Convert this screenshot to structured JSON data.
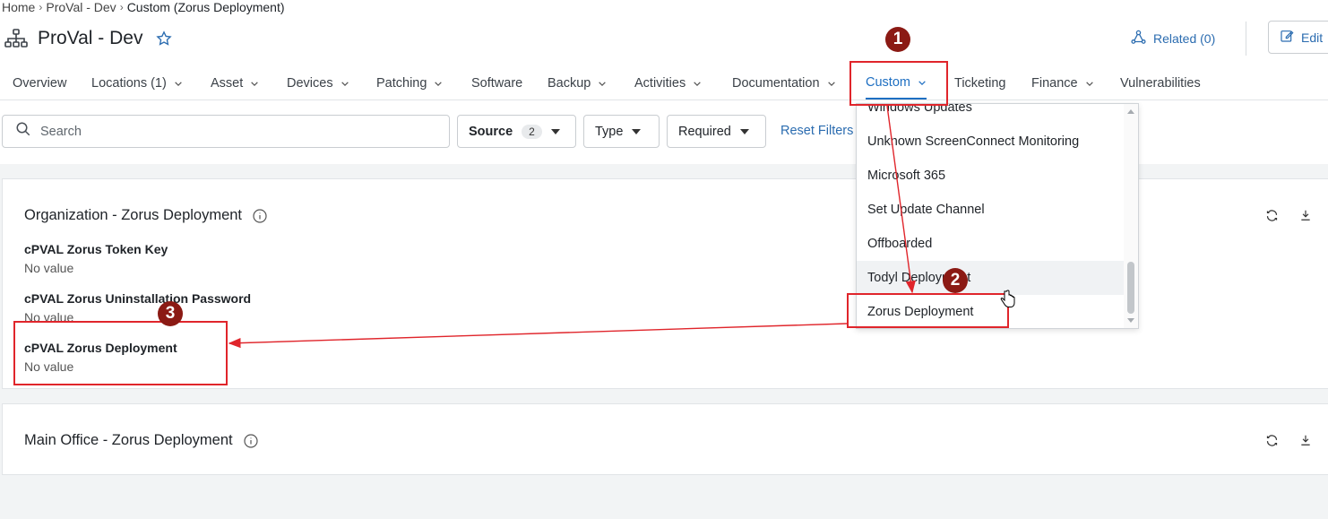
{
  "breadcrumb": [
    "Home",
    "ProVal - Dev",
    "Custom (Zorus Deployment)"
  ],
  "header": {
    "title": "ProVal - Dev",
    "related_label": "Related (0)",
    "edit_label": "Edit"
  },
  "tabs": [
    {
      "label": "Overview"
    },
    {
      "label": "Locations (1)"
    },
    {
      "label": "Asset"
    },
    {
      "label": "Devices"
    },
    {
      "label": "Patching"
    },
    {
      "label": "Software"
    },
    {
      "label": "Backup"
    },
    {
      "label": "Activities"
    },
    {
      "label": "Documentation"
    },
    {
      "label": "Custom",
      "active": true
    },
    {
      "label": "Ticketing"
    },
    {
      "label": "Finance"
    },
    {
      "label": "Vulnerabilities"
    }
  ],
  "filters": {
    "search_placeholder": "Search",
    "source_label": "Source",
    "source_count": "2",
    "type_label": "Type",
    "required_label": "Required",
    "reset_label": "Reset Filters"
  },
  "dropdown": {
    "items": [
      "Windows Updates",
      "Unknown ScreenConnect Monitoring",
      "Microsoft 365",
      "Set Update Channel",
      "Offboarded",
      "Todyl Deployment",
      "Zorus Deployment"
    ],
    "hovered_index": 5
  },
  "cards": [
    {
      "title": "Organization - Zorus Deployment",
      "fields": [
        {
          "label": "cPVAL Zorus Token Key",
          "value": "No value"
        },
        {
          "label": "cPVAL Zorus Uninstallation Password",
          "value": "No value"
        },
        {
          "label": "cPVAL Zorus Deployment",
          "value": "No value"
        }
      ]
    },
    {
      "title": "Main Office - Zorus Deployment",
      "fields": []
    }
  ],
  "annotations": [
    "1",
    "2",
    "3"
  ],
  "colors": {
    "accent": "#1e6fc2",
    "link": "#2b6cb0",
    "annotation_red": "#e0252b",
    "step_badge": "#8b1a14"
  }
}
